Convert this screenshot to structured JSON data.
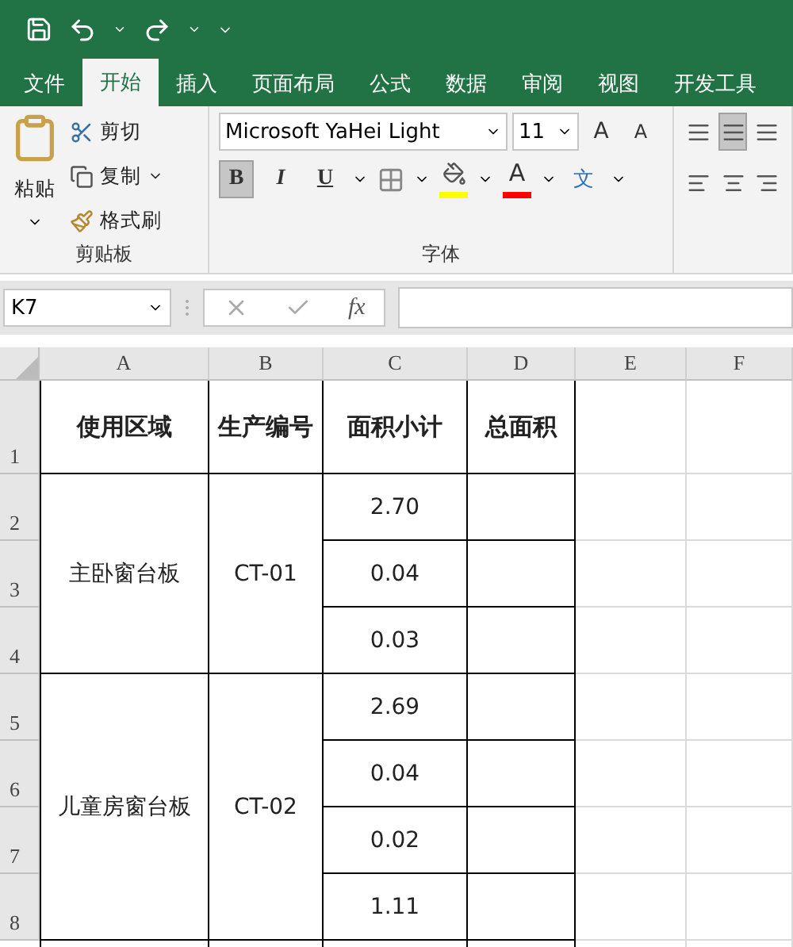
{
  "tabs": [
    {
      "label": "文件",
      "selected": false
    },
    {
      "label": "开始",
      "selected": true
    },
    {
      "label": "插入",
      "selected": false
    },
    {
      "label": "页面布局",
      "selected": false
    },
    {
      "label": "公式",
      "selected": false
    },
    {
      "label": "数据",
      "selected": false
    },
    {
      "label": "审阅",
      "selected": false
    },
    {
      "label": "视图",
      "selected": false
    },
    {
      "label": "开发工具",
      "selected": false
    }
  ],
  "clipboard": {
    "paste": "粘贴",
    "cut": "剪切",
    "copy": "复制",
    "format_painter": "格式刷",
    "label": "剪贴板"
  },
  "font": {
    "name": "Microsoft YaHei Light",
    "size": "11",
    "grow": "A",
    "shrink": "A",
    "bold": {
      "label": "B",
      "selected": true
    },
    "italic": {
      "label": "I",
      "selected": false
    },
    "underline": {
      "label": "U",
      "selected": false
    },
    "font_color_label": "A",
    "phonetic": "文",
    "label": "字体"
  },
  "alignment": {
    "vertical": [
      {
        "selected": false
      },
      {
        "selected": true
      },
      {
        "selected": false
      }
    ],
    "horizontal": [
      {
        "selected": false
      },
      {
        "selected": false
      },
      {
        "selected": false
      }
    ]
  },
  "formula_bar": {
    "name_box": "K7",
    "fx": "fx"
  },
  "sheet": {
    "columns": [
      "A",
      "B",
      "C",
      "D",
      "E",
      "F"
    ],
    "row_numbers": [
      "1",
      "2",
      "3",
      "4",
      "5",
      "6",
      "7",
      "8"
    ],
    "header": [
      "使用区域",
      "生产编号",
      "面积小计",
      "总面积"
    ],
    "groups": [
      {
        "area": "主卧窗台板",
        "code": "CT-01",
        "subtotals": [
          "2.70",
          "0.04",
          "0.03"
        ]
      },
      {
        "area": "儿童房窗台板",
        "code": "CT-02",
        "subtotals": [
          "2.69",
          "0.04",
          "0.02",
          "1.11"
        ]
      }
    ]
  }
}
